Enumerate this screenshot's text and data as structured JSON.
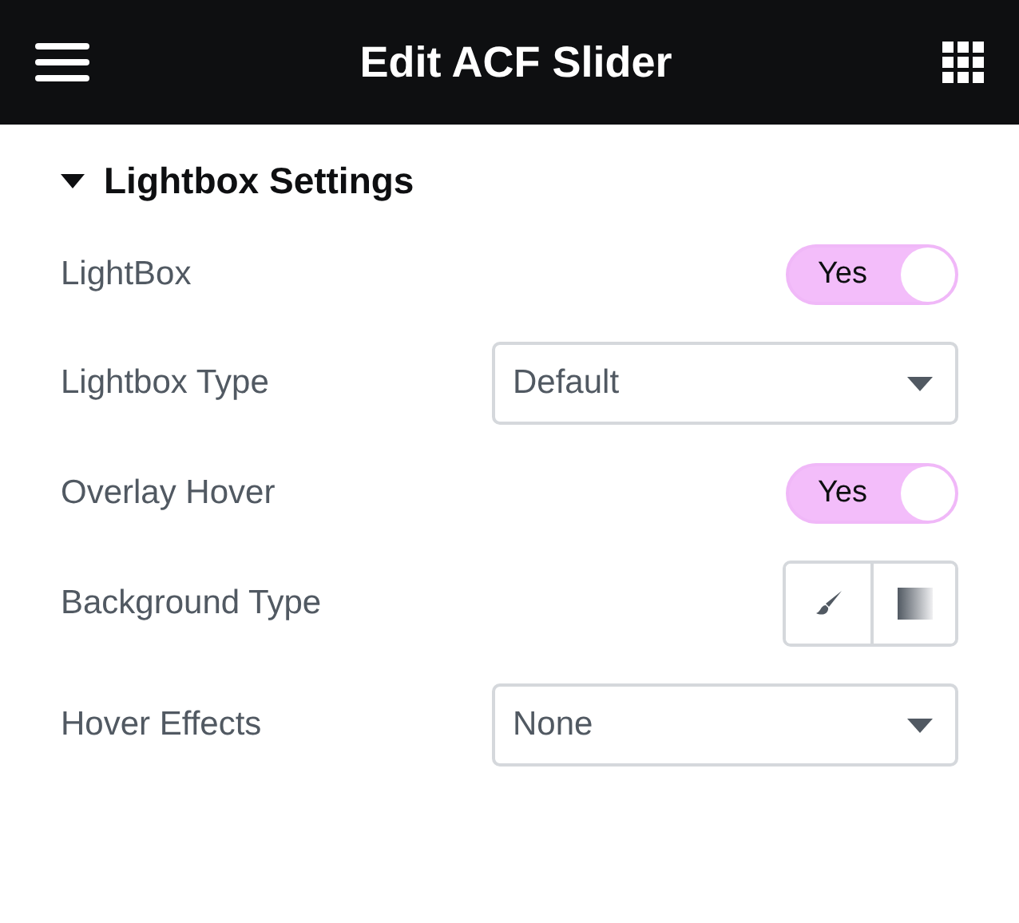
{
  "header": {
    "title": "Edit ACF Slider"
  },
  "section": {
    "title": "Lightbox Settings",
    "expanded": true
  },
  "controls": [
    {
      "kind": "toggle",
      "label": "LightBox",
      "on": true,
      "on_text": "Yes"
    },
    {
      "kind": "select",
      "label": "Lightbox Type",
      "value": "Default"
    },
    {
      "kind": "toggle",
      "label": "Overlay Hover",
      "on": true,
      "on_text": "Yes"
    },
    {
      "kind": "choices",
      "label": "Background Type",
      "options": [
        {
          "kind": "classic",
          "selected": false
        },
        {
          "kind": "gradient",
          "selected": false
        }
      ]
    },
    {
      "kind": "select",
      "label": "Hover Effects",
      "value": "None"
    }
  ]
}
